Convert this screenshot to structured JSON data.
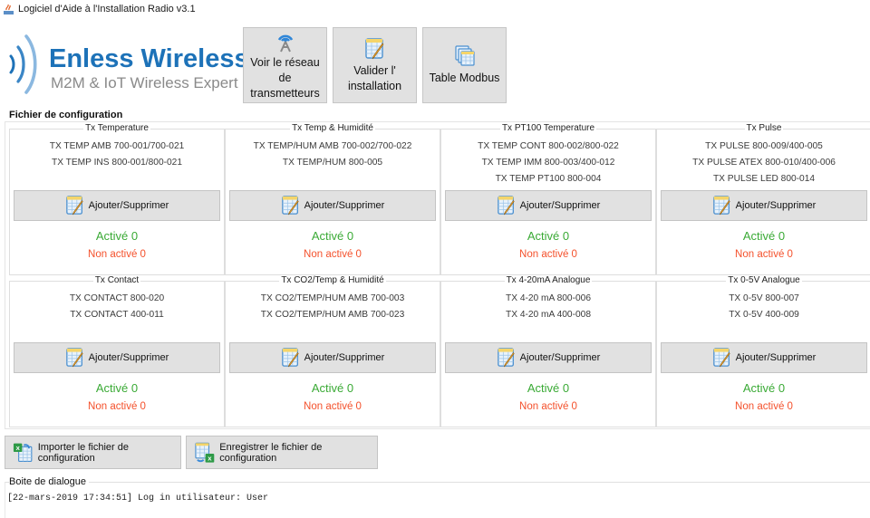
{
  "window": {
    "title": "Logiciel d'Aide à l'Installation Radio v3.1",
    "icon": "java-app-icon"
  },
  "logo": {
    "name": "Enless Wireless",
    "tagline": "M2M & IoT Wireless Expert",
    "icon": "radio-waves-icon",
    "brand_color": "#1d72b8"
  },
  "toolbar": {
    "network": {
      "label_line1": "Voir le réseau de",
      "label_line2": "transmetteurs",
      "icon": "antenna-icon"
    },
    "validate": {
      "label_line1": "Valider l'",
      "label_line2": "installation",
      "icon": "table-pencil-icon"
    },
    "modbus": {
      "label": "Table Modbus",
      "icon": "stacked-tables-icon"
    }
  },
  "config": {
    "section_title": "Fichier de configuration",
    "add_remove_label": "Ajouter/Supprimer",
    "active_color": "#3aaa35",
    "inactive_color": "#f4512c",
    "panels": [
      {
        "title": "Tx Temperature",
        "models": [
          "TX TEMP AMB 700-001/700-021",
          "TX TEMP INS 800-001/800-021"
        ],
        "active": "Activé 0",
        "inactive": "Non activé 0"
      },
      {
        "title": "Tx Temp & Humidité",
        "models": [
          "TX TEMP/HUM AMB 700-002/700-022",
          "TX TEMP/HUM 800-005"
        ],
        "active": "Activé 0",
        "inactive": "Non activé 0"
      },
      {
        "title": "Tx PT100 Temperature",
        "models": [
          "TX TEMP CONT 800-002/800-022",
          "TX TEMP IMM 800-003/400-012",
          "TX TEMP PT100 800-004"
        ],
        "active": "Activé 0",
        "inactive": "Non activé 0"
      },
      {
        "title": "Tx Pulse",
        "models": [
          "TX PULSE 800-009/400-005",
          "TX PULSE ATEX 800-010/400-006",
          "TX PULSE LED 800-014"
        ],
        "active": "Activé 0",
        "inactive": "Non activé 0"
      },
      {
        "title": "Tx Contact",
        "models": [
          "TX CONTACT 800-020",
          "TX CONTACT 400-011"
        ],
        "active": "Activé 0",
        "inactive": "Non activé 0"
      },
      {
        "title": "Tx CO2/Temp & Humidité",
        "models": [
          "TX CO2/TEMP/HUM AMB 700-003",
          "TX CO2/TEMP/HUM AMB 700-023"
        ],
        "active": "Activé 0",
        "inactive": "Non activé 0"
      },
      {
        "title": "Tx 4-20mA Analogue",
        "models": [
          "TX 4-20 mA 800-006",
          "TX 4-20 mA 400-008"
        ],
        "active": "Activé 0",
        "inactive": "Non activé 0"
      },
      {
        "title": "Tx 0-5V Analogue",
        "models": [
          "TX 0-5V 800-007",
          "TX 0-5V 400-009"
        ],
        "active": "Activé 0",
        "inactive": "Non activé 0"
      }
    ]
  },
  "actions": {
    "import_label": "Importer le fichier de configuration",
    "import_icon": "excel-import-icon",
    "save_label": "Enregistrer le fichier de configuration",
    "save_icon": "excel-export-icon"
  },
  "dialog": {
    "section_title": "Boite de dialogue",
    "log": [
      "[22-mars-2019 17:34:51] Log in utilisateur: User"
    ]
  }
}
